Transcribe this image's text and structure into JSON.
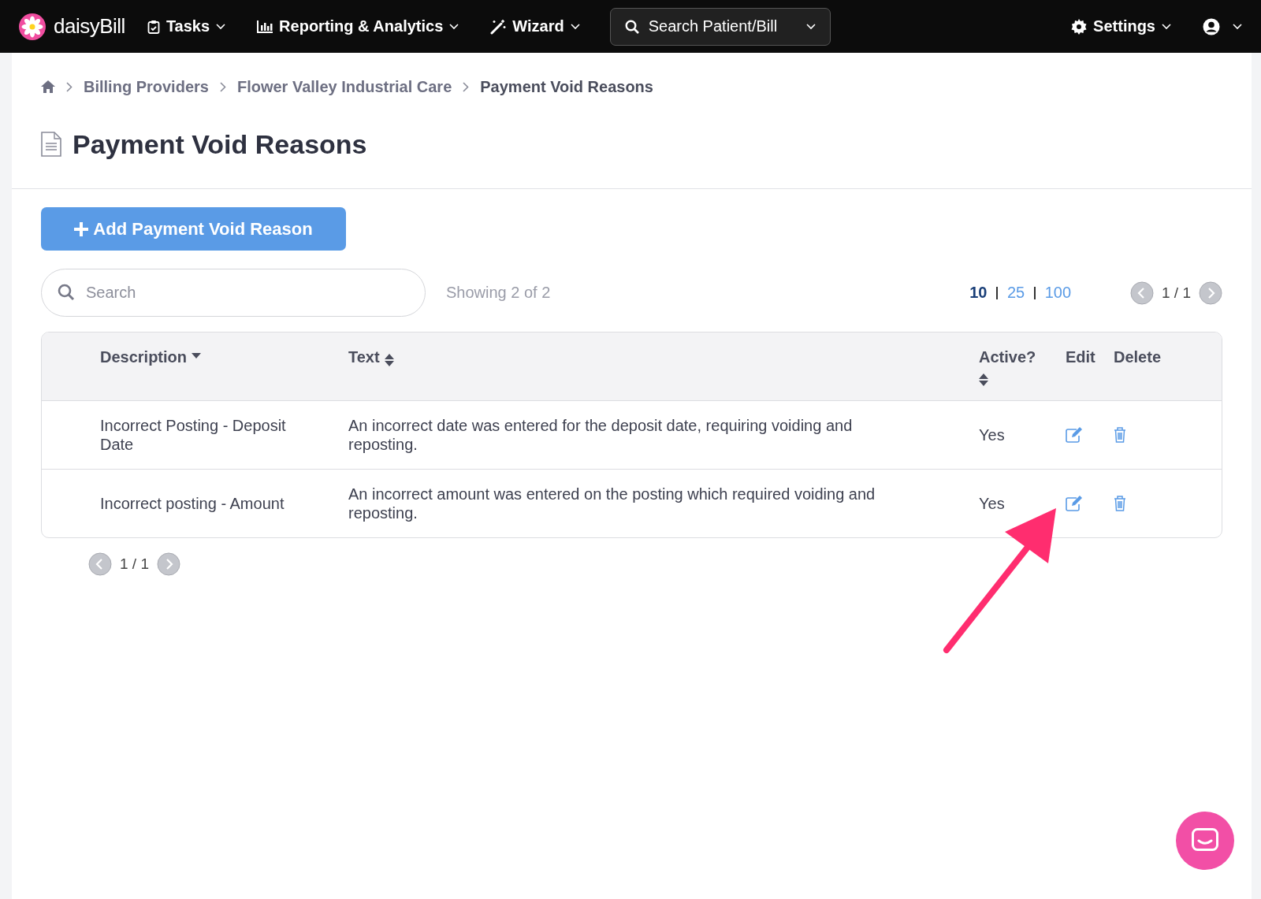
{
  "navbar": {
    "logo": "daisyBill",
    "menus": [
      {
        "label": "Tasks"
      },
      {
        "label": "Reporting & Analytics"
      },
      {
        "label": "Wizard"
      }
    ],
    "search": {
      "label": "Search Patient/Bill"
    },
    "settings": {
      "label": "Settings"
    }
  },
  "breadcrumb": [
    {
      "label": "Billing Providers",
      "current": false
    },
    {
      "label": "Flower Valley Industrial Care",
      "current": false
    },
    {
      "label": "Payment Void Reasons",
      "current": true
    }
  ],
  "page_title": "Payment Void Reasons",
  "add_button": {
    "label": "Add Payment Void Reason"
  },
  "search": {
    "placeholder": "Search"
  },
  "showing": "Showing 2 of 2",
  "page_sizes": [
    {
      "label": "10",
      "selected": true
    },
    {
      "label": "25",
      "selected": false
    },
    {
      "label": "100",
      "selected": false
    }
  ],
  "pager_top": "1 / 1",
  "table": {
    "columns": [
      {
        "label": "Description",
        "sortable": true,
        "sorted": true
      },
      {
        "label": "Text",
        "sortable": true,
        "sorted": false
      },
      {
        "label": "Active?",
        "sortable": true,
        "sorted": false
      },
      {
        "label": "Edit",
        "sortable": false,
        "sorted": false
      },
      {
        "label": "Delete",
        "sortable": false,
        "sorted": false
      }
    ],
    "rows": [
      {
        "description": "Incorrect Posting - Deposit Date",
        "text": "An incorrect date was entered for the deposit date, requiring voiding and reposting.",
        "active": "Yes"
      },
      {
        "description": "Incorrect posting - Amount",
        "text": "An incorrect amount was entered on the posting which required voiding and reposting.",
        "active": "Yes"
      }
    ]
  },
  "pager_bottom": "1 / 1"
}
